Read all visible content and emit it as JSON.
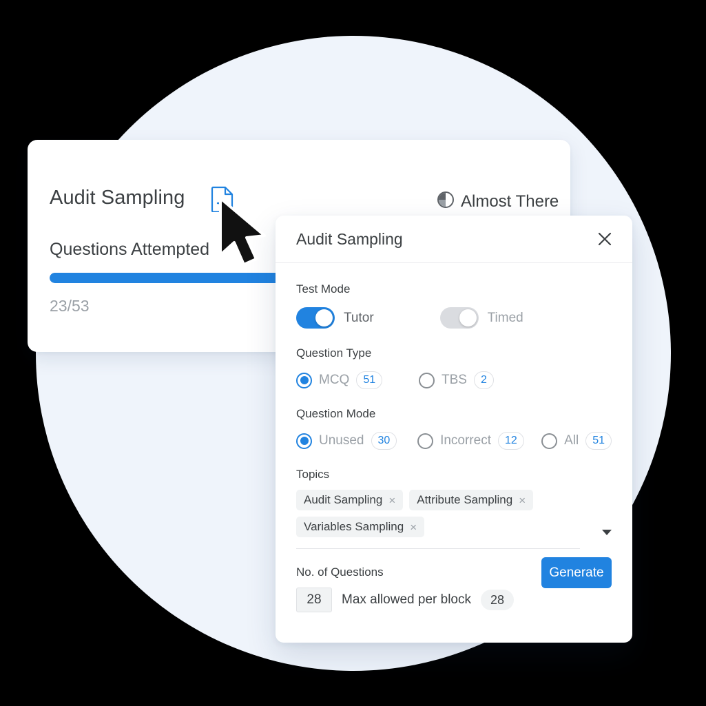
{
  "theme": {
    "accent": "#2183e0",
    "circle_bg": "#eff4fb",
    "card_bg": "#ffffff",
    "muted_text": "#9aa0a6",
    "body_text": "#3c4043"
  },
  "back_card": {
    "title": "Audit Sampling",
    "add_icon": "document-add-icon",
    "status": {
      "icon": "pie-progress-icon",
      "label": "Almost There"
    },
    "progress": {
      "label": "Questions Attempted",
      "completed": 23,
      "total": 53,
      "count_text": "23/53",
      "percent": 100
    }
  },
  "cursor": {
    "icon": "mouse-pointer-icon"
  },
  "modal": {
    "title": "Audit Sampling",
    "close_icon": "close-icon",
    "test_mode": {
      "label": "Test Mode",
      "options": [
        {
          "label": "Tutor",
          "state": "on"
        },
        {
          "label": "Timed",
          "state": "off"
        }
      ]
    },
    "question_type": {
      "label": "Question Type",
      "options": [
        {
          "label": "MCQ",
          "count": "51",
          "selected": true
        },
        {
          "label": "TBS",
          "count": "2",
          "selected": false
        }
      ]
    },
    "question_mode": {
      "label": "Question Mode",
      "options": [
        {
          "label": "Unused",
          "count": "30",
          "selected": true
        },
        {
          "label": "Incorrect",
          "count": "12",
          "selected": false
        },
        {
          "label": "All",
          "count": "51",
          "selected": false
        }
      ]
    },
    "topics": {
      "label": "Topics",
      "chips": [
        {
          "label": "Audit Sampling",
          "remove": "×"
        },
        {
          "label": "Attribute Sampling",
          "remove": "×"
        },
        {
          "label": "Variables Sampling",
          "remove": "×"
        }
      ],
      "dropdown_icon": "chevron-down-icon"
    },
    "questions": {
      "label": "No. of Questions",
      "value": "28",
      "max_label": "Max allowed per block",
      "max_value": "28"
    },
    "generate_label": "Generate"
  }
}
